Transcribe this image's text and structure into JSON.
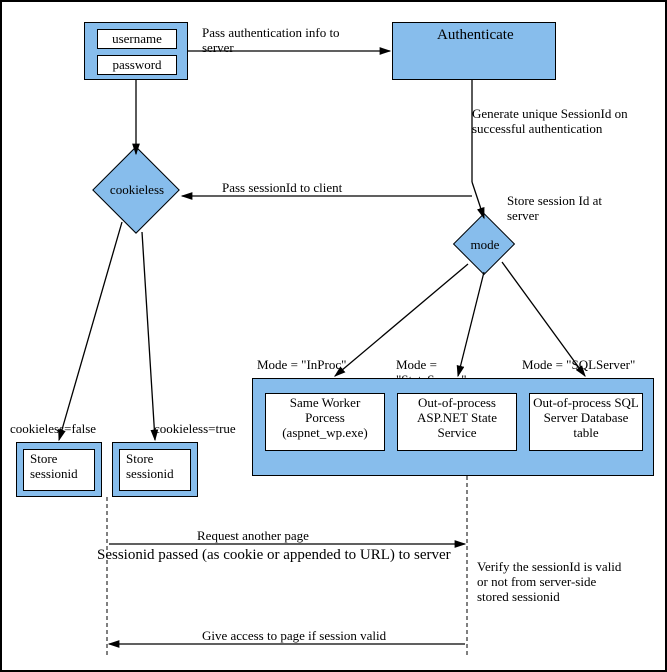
{
  "login": {
    "username": "username",
    "password": "password"
  },
  "auth": {
    "title": "Authenticate"
  },
  "arrows": {
    "pass_auth": "Pass authentication info to server",
    "gen_session": "Generate unique SessionId on successful authentication",
    "pass_session": "Pass sessionId to client",
    "store_session_server": "Store session Id at server"
  },
  "decisions": {
    "cookieless": "cookieless",
    "mode": "mode"
  },
  "cookieless_branches": {
    "false_label": "cookieless=false",
    "true_label": "cookieless=true",
    "store_false": "Store sessionid",
    "store_true": "Store sessionid"
  },
  "mode_branches": {
    "inproc_label": "Mode = \"InProc\"",
    "stateserver_label": "Mode = \"StateServer\"",
    "sqlserver_label": "Mode = \"SQLServer\"",
    "inproc_box": "Same Worker Porcess (aspnet_wp.exe)",
    "stateserver_box": "Out-of-process ASP.NET State Service",
    "sqlserver_box": "Out-of-process SQL Server Database table"
  },
  "sequence": {
    "request": "Request another page",
    "passed": "Sessionid passed (as cookie or appended to URL) to server",
    "verify": "Verify the sessionId is valid or not from server-side stored sessionid",
    "give_access": "Give access to page if session valid"
  }
}
